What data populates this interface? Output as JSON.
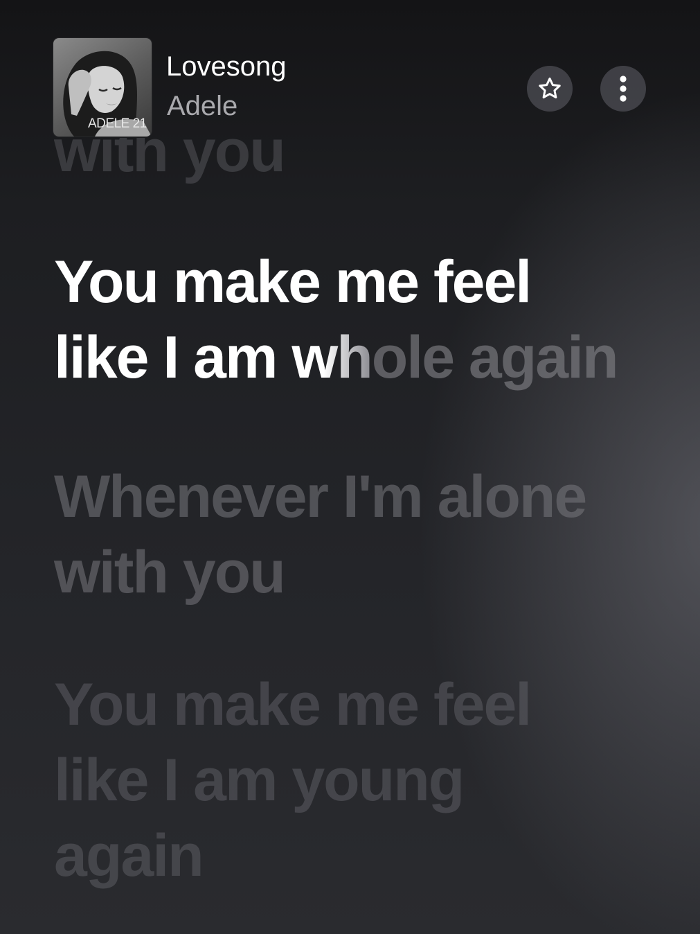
{
  "header": {
    "album_cover": {
      "caption": "ADELE 21",
      "icon": "album-cover"
    },
    "title": "Lovesong",
    "artist": "Adele",
    "favorite_button": {
      "icon": "star-outline-icon"
    },
    "more_button": {
      "icon": "vertical-ellipsis-icon"
    }
  },
  "lyrics": {
    "previous": {
      "lines": [
        "with you"
      ]
    },
    "current": {
      "line1": "You make me feel",
      "line2_sung_a": "like I am ",
      "line2_sung_b": "wh",
      "line2_unsung": "ole again"
    },
    "upcoming": [
      {
        "lines": [
          "Whenever I'm alone",
          "with you"
        ]
      },
      {
        "lines": [
          "You make me feel",
          "like I am young",
          "again"
        ]
      }
    ]
  },
  "colors": {
    "background": "#1d1e21",
    "active_lyric": "#ffffff",
    "artist_text": "#a9a9ad",
    "button_bg": "#5c5c62"
  }
}
